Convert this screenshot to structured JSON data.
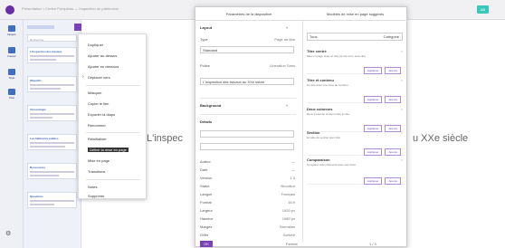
{
  "topbar": {
    "title": "Présentation • Centre Pompidou — Inspection du patrimoine",
    "avatar": "AB"
  },
  "rail": {
    "items": [
      {
        "label": "Diapos",
        "icon": "slides-icon"
      },
      {
        "label": "Insérer",
        "icon": "insert-icon"
      },
      {
        "label": "Style",
        "icon": "style-icon"
      },
      {
        "label": "Plus",
        "icon": "more-icon"
      }
    ]
  },
  "slides": {
    "header": "Diapos",
    "search_placeholder": "Rechercher",
    "thumbs": [
      {
        "title": "L'inspection des travaux"
      },
      {
        "title": "Objectifs"
      },
      {
        "title": "Chronologie"
      },
      {
        "title": "Les bâtiments publics"
      },
      {
        "title": "Ressources"
      },
      {
        "title": "Questions"
      }
    ]
  },
  "menu": {
    "items": [
      "Dupliquer",
      "Ajouter au-dessus",
      "Ajouter en dessous",
      "Déplacer vers",
      "Masquer",
      "Copier le lien",
      "Exporter la diapo",
      "Renommer",
      "Réinitialiser",
      "Définir la mise en page",
      "Mise en page",
      "Transitions",
      "Notes",
      "Supprimer"
    ],
    "selected_index": 9
  },
  "canvas": {
    "title_left": "L'inspec",
    "title_right": "u XXe siècle"
  },
  "panel": {
    "tab_left": "Paramètres de la diapositive",
    "tab_right": "Modèles de mise en page suggérés",
    "layout_section": "Layout",
    "fields": [
      {
        "label": "Type",
        "value": "Page de titre"
      },
      {
        "label": "Thème",
        "value": "Standard"
      },
      {
        "label": "Police",
        "value": "Liberation Sans"
      },
      {
        "label": "Titre",
        "value": "L'inspection des travaux au XXe siècle"
      }
    ],
    "bg_section": "Background",
    "details_section": "Détails",
    "detail_rows": [
      {
        "label": "Auteur",
        "value": "—"
      },
      {
        "label": "Date",
        "value": "—"
      },
      {
        "label": "Version",
        "value": "1.0"
      },
      {
        "label": "Statut",
        "value": "Brouillon"
      },
      {
        "label": "Langue",
        "value": "Français"
      },
      {
        "label": "Format",
        "value": "16:9"
      },
      {
        "label": "Largeur",
        "value": "1920 px"
      },
      {
        "label": "Hauteur",
        "value": "1080 px"
      },
      {
        "label": "Marges",
        "value": "Normales"
      },
      {
        "label": "Grille",
        "value": "Activée"
      }
    ],
    "ok_label": "OK",
    "close_label": "Fermer",
    "filter_label": "Tous",
    "filter_value": "Catégorie",
    "cards": [
      {
        "title": "Titre centré",
        "desc": "Mise en page avec un titre centré et un sous-titre",
        "apply": "Appliquer",
        "preview": "Aperçu"
      },
      {
        "title": "Titre et contenu",
        "desc": "Un titre avec une zone de contenu",
        "apply": "Appliquer",
        "preview": "Aperçu"
      },
      {
        "title": "Deux colonnes",
        "desc": "Deux zones de contenu côte à côte",
        "apply": "Appliquer",
        "preview": "Aperçu"
      },
      {
        "title": "Section",
        "desc": "En-tête de section avec titre",
        "apply": "Appliquer",
        "preview": "Aperçu"
      },
      {
        "title": "Comparaison",
        "desc": "Comparer deux éléments avec des titres",
        "apply": "Appliquer",
        "preview": "Aperçu"
      }
    ],
    "pager": "1 / 3"
  }
}
